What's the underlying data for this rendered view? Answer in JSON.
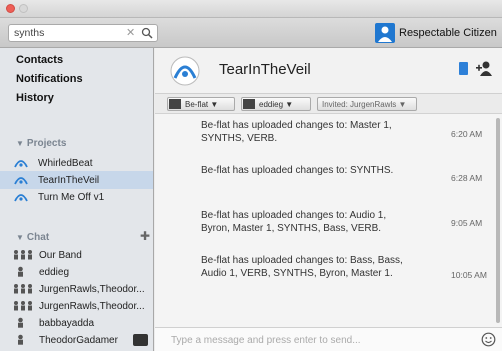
{
  "search": {
    "value": "synths"
  },
  "user": {
    "name": "Respectable Citizen"
  },
  "nav": [
    "Contacts",
    "Notifications",
    "History"
  ],
  "projects_section": {
    "title": "Projects"
  },
  "projects": [
    {
      "label": "WhirledBeat"
    },
    {
      "label": "TearInTheVeil"
    },
    {
      "label": "Turn Me Off v1"
    }
  ],
  "chat_section": {
    "title": "Chat"
  },
  "chats": [
    {
      "label": "Our Band"
    },
    {
      "label": "eddieg"
    },
    {
      "label": "JurgenRawls,Theodor..."
    },
    {
      "label": "JurgenRawls,Theodor..."
    },
    {
      "label": "babbayadda"
    },
    {
      "label": "TheodorGadamer"
    }
  ],
  "project": {
    "title": "TearInTheVeil"
  },
  "filters": {
    "chip1": "Be-flat ▼",
    "chip2": "eddieg ▼",
    "invited": "Invited: JurgenRawls ▼"
  },
  "messages": [
    {
      "text": "Be-flat has uploaded changes to: Master 1, SYNTHS, VERB.",
      "time": "6:20 AM"
    },
    {
      "text": "Be-flat has uploaded changes to: SYNTHS.",
      "time": "6:28 AM"
    },
    {
      "text": "Be-flat has uploaded changes to: Audio 1, Byron, Master 1, SYNTHS, Bass, VERB.",
      "time": "9:05 AM"
    },
    {
      "text": "Be-flat has uploaded changes to: Bass, Bass, Audio 1, VERB, SYNTHS, Byron, Master 1.",
      "time": "10:05 AM"
    }
  ],
  "composer": {
    "placeholder": "Type a message and press enter to send..."
  },
  "colors": {
    "accent": "#1f77d0",
    "selected": "#c7d7ea"
  }
}
